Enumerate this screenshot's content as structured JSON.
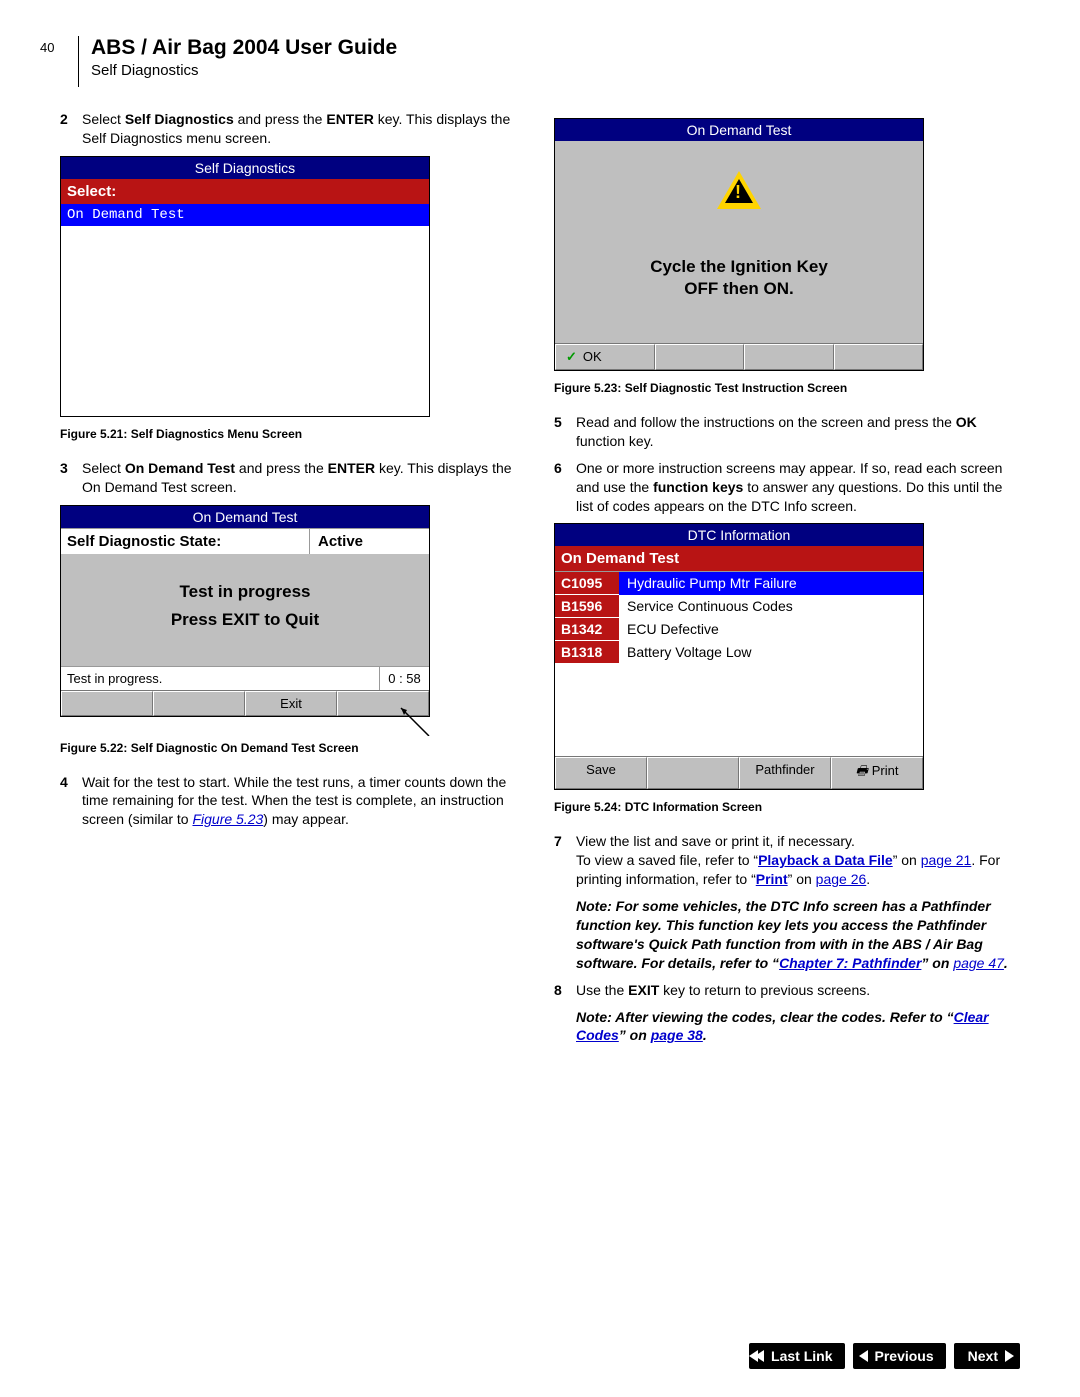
{
  "page_number": "40",
  "header_title": "ABS / Air Bag 2004 User Guide",
  "header_sub": "Self Diagnostics",
  "left": {
    "step2_num": "2",
    "step2_a": "Select ",
    "step2_b": "Self Diagnostics",
    "step2_c": " and press the ",
    "step2_d": "ENTER",
    "step2_e": " key. This displays the Self Diagnostics menu screen.",
    "fig21": {
      "title": "Self Diagnostics",
      "select": "Select:",
      "item": "On Demand Test"
    },
    "cap21": "Figure 5.21: Self Diagnostics Menu Screen",
    "step3_num": "3",
    "step3_a": "Select ",
    "step3_b": "On Demand Test",
    "step3_c": " and press the ",
    "step3_d": "ENTER",
    "step3_e": " key. This displays the On Demand Test screen.",
    "fig22": {
      "title": "On Demand Test",
      "state_label": "Self Diagnostic State:",
      "state_val": "Active",
      "line1": "Test in progress",
      "line2": "Press EXIT to Quit",
      "footer_msg": "Test in progress.",
      "footer_time": "0 : 58",
      "btn_exit": "Exit"
    },
    "cap22": "Figure 5.22: Self Diagnostic On Demand Test Screen",
    "step4_num": "4",
    "step4_a": "Wait for the test to start. While the test runs, a timer counts down the time remaining for the test. When the test is complete, an instruction screen (similar to ",
    "step4_link": "Figure 5.23",
    "step4_b": ") may appear."
  },
  "right": {
    "fig23": {
      "title": "On Demand Test",
      "msg1": "Cycle the Ignition Key",
      "msg2": "OFF  then  ON.",
      "ok": "OK"
    },
    "cap23": "Figure 5.23: Self Diagnostic Test Instruction Screen",
    "step5_num": "5",
    "step5_a": "Read and follow the instructions on the screen and press the ",
    "step5_b": "OK",
    "step5_c": " function key.",
    "step6_num": "6",
    "step6_a": "One or more instruction screens may appear. If so, read each screen and use the ",
    "step6_b": "function keys",
    "step6_c": " to answer any questions. Do this until the list of codes appears on the DTC Info screen.",
    "fig24": {
      "title": "DTC Information",
      "subtitle": "On Demand Test",
      "codes": [
        {
          "c": "C1095",
          "d": "Hydraulic Pump Mtr Failure",
          "hi": true
        },
        {
          "c": "B1596",
          "d": "Service Continuous Codes",
          "hi": false
        },
        {
          "c": "B1342",
          "d": "ECU Defective",
          "hi": false
        },
        {
          "c": "B1318",
          "d": "Battery Voltage Low",
          "hi": false
        }
      ],
      "btn_save": "Save",
      "btn_path": "Pathfinder",
      "btn_print": "Print"
    },
    "cap24": "Figure 5.24: DTC Information Screen",
    "step7_num": "7",
    "step7_a": "View the list and save or print it, if necessary.",
    "step7_b": "To view a saved file, refer to “",
    "step7_link1": "Playback a Data File",
    "step7_c": "” on ",
    "step7_pg1": "page 21",
    "step7_d": ". For printing information, refer to “",
    "step7_link2": "Print",
    "step7_e": "” on ",
    "step7_pg2": "page 26",
    "step7_f": ".",
    "note1_a": "Note:  For some vehicles, the DTC Info screen has a Pathfinder function key. This function key lets you access the Pathfinder software's Quick Path function from with in the ABS / Air Bag software. For details, refer to “",
    "note1_link": "Chapter 7: Pathfinder",
    "note1_b": "” on ",
    "note1_pg": "page 47",
    "note1_c": ".",
    "step8_num": "8",
    "step8_a": "Use the ",
    "step8_b": "EXIT",
    "step8_c": " key to return to previous screens.",
    "note2_a": "Note:  After viewing the codes, clear the codes. Refer to “",
    "note2_link": "Clear Codes",
    "note2_b": "” on ",
    "note2_pg": "page 38",
    "note2_c": "."
  },
  "nav": {
    "last": "Last Link",
    "prev": "Previous",
    "next": "Next"
  }
}
